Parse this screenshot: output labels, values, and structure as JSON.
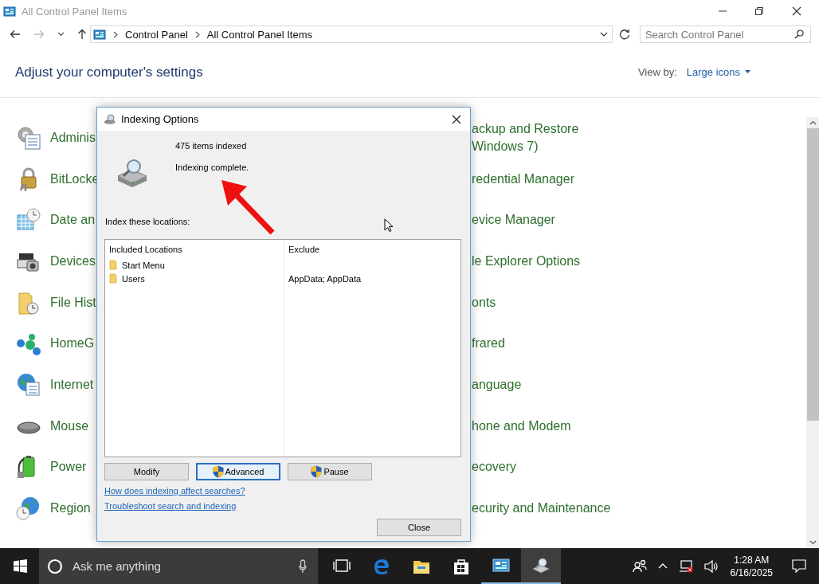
{
  "window": {
    "title": "All Control Panel Items"
  },
  "address_bar": {
    "breadcrumbs": [
      "Control Panel",
      "All Control Panel Items"
    ],
    "search_placeholder": "Search Control Panel"
  },
  "header": {
    "title": "Adjust your computer's settings",
    "view_by_label": "View by:",
    "view_by_value": "Large icons"
  },
  "left_items": [
    {
      "label": "Adminis"
    },
    {
      "label": "BitLocke"
    },
    {
      "label": "Date an"
    },
    {
      "label": "Devices"
    },
    {
      "label": "File Hist"
    },
    {
      "label": "HomeG"
    },
    {
      "label": "Internet"
    },
    {
      "label": "Mouse"
    },
    {
      "label": "Power"
    },
    {
      "label": "Region"
    }
  ],
  "right_items": [
    {
      "label": "ackup and Restore",
      "label_2": "Windows 7)"
    },
    {
      "label": "redential Manager"
    },
    {
      "label": "evice Manager"
    },
    {
      "label": "le Explorer Options"
    },
    {
      "label": "onts"
    },
    {
      "label": "frared"
    },
    {
      "label": "anguage"
    },
    {
      "label": "hone and Modem"
    },
    {
      "label": "ecovery"
    },
    {
      "label": "ecurity and Maintenance"
    }
  ],
  "dialog": {
    "title": "Indexing Options",
    "items_indexed": "475 items indexed",
    "status": "Indexing complete.",
    "locations_label": "Index these locations:",
    "columns": [
      "Included Locations",
      "Exclude"
    ],
    "rows": [
      {
        "location": "Start Menu"
      },
      {
        "location": "Users",
        "exclude": "AppData; AppData"
      }
    ],
    "buttons": [
      {
        "label": "Modify",
        "shield": false,
        "focused": false
      },
      {
        "label": "Advanced",
        "shield": true,
        "focused": true
      },
      {
        "label": "Pause",
        "shield": true,
        "focused": false
      }
    ],
    "links": [
      "How does indexing affect searches?",
      "Troubleshoot search and indexing"
    ],
    "close_button": "Close"
  },
  "taskbar": {
    "search_placeholder": "Ask me anything",
    "apps": [
      {
        "kind": "task-view",
        "open": false,
        "active": false
      },
      {
        "kind": "edge",
        "open": false,
        "active": false
      },
      {
        "kind": "explorer",
        "open": false,
        "active": false
      },
      {
        "kind": "store",
        "open": false,
        "active": false
      },
      {
        "kind": "control-panel",
        "open": true,
        "active": false
      },
      {
        "kind": "indexing",
        "open": true,
        "active": true
      }
    ],
    "time": "1:28 AM",
    "date": "6/16/2025"
  }
}
